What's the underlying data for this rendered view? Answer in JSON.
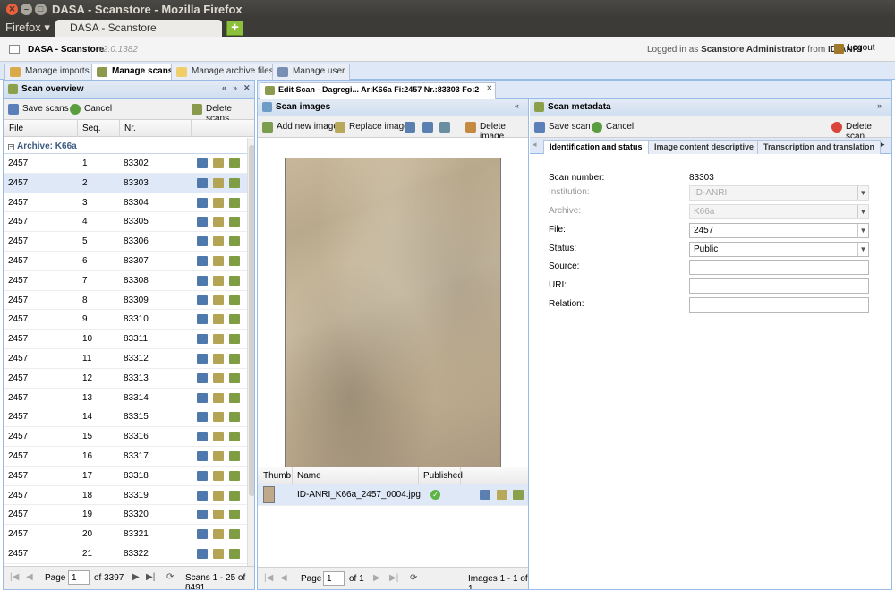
{
  "window": {
    "title": "DASA - Scanstore - Mozilla Firefox",
    "menu": "Firefox ▾",
    "tab": "DASA - Scanstore",
    "new_tab": "+"
  },
  "app": {
    "name": "DASA - Scanstore",
    "version": "v2.0.1382",
    "login_prefix": "Logged in as",
    "user": "Scanstore Administrator",
    "from": "from",
    "institution": "ID-ANRI",
    "logout": "Logout"
  },
  "main_tabs": [
    "Manage imports",
    "Manage scans",
    "Manage archive files",
    "Manage user"
  ],
  "overview": {
    "title": "Scan overview",
    "save": "Save scans",
    "cancel": "Cancel",
    "delete": "Delete scans",
    "columns": [
      "File",
      "Seq.",
      "Nr."
    ],
    "group": "Archive: K66a",
    "rows": [
      [
        "2457",
        "1",
        "83302"
      ],
      [
        "2457",
        "2",
        "83303"
      ],
      [
        "2457",
        "3",
        "83304"
      ],
      [
        "2457",
        "4",
        "83305"
      ],
      [
        "2457",
        "5",
        "83306"
      ],
      [
        "2457",
        "6",
        "83307"
      ],
      [
        "2457",
        "7",
        "83308"
      ],
      [
        "2457",
        "8",
        "83309"
      ],
      [
        "2457",
        "9",
        "83310"
      ],
      [
        "2457",
        "10",
        "83311"
      ],
      [
        "2457",
        "11",
        "83312"
      ],
      [
        "2457",
        "12",
        "83313"
      ],
      [
        "2457",
        "13",
        "83314"
      ],
      [
        "2457",
        "14",
        "83315"
      ],
      [
        "2457",
        "15",
        "83316"
      ],
      [
        "2457",
        "16",
        "83317"
      ],
      [
        "2457",
        "17",
        "83318"
      ],
      [
        "2457",
        "18",
        "83319"
      ],
      [
        "2457",
        "19",
        "83320"
      ],
      [
        "2457",
        "20",
        "83321"
      ],
      [
        "2457",
        "21",
        "83322"
      ]
    ],
    "pager": {
      "page_label": "Page",
      "page": "1",
      "of": "of 3397",
      "summary": "Scans 1 - 25 of 8491"
    }
  },
  "edit_tab": "Edit Scan - Dagregi... Ar:K66a Fi:2457 Nr.:83303 Fo:2",
  "images": {
    "title": "Scan images",
    "add": "Add new image",
    "replace": "Replace image",
    "delete": "Delete image",
    "columns": [
      "Thumb",
      "Name",
      "Published"
    ],
    "file": "ID-ANRI_K66a_2457_0004.jpg",
    "pager": {
      "page_label": "Page",
      "page": "1",
      "of": "of 1",
      "summary": "Images 1 - 1 of 1"
    }
  },
  "metadata": {
    "title": "Scan metadata",
    "save": "Save scan",
    "cancel": "Cancel",
    "delete": "Delete scan",
    "tabs": [
      "Identification and status",
      "Image content descriptive",
      "Transcription and translation"
    ],
    "fields": {
      "scan_number_label": "Scan number:",
      "scan_number": "83303",
      "institution_label": "Institution:",
      "institution": "ID-ANRI",
      "archive_label": "Archive:",
      "archive": "K66a",
      "file_label": "File:",
      "file": "2457",
      "status_label": "Status:",
      "status": "Public",
      "source_label": "Source:",
      "uri_label": "URI:",
      "relation_label": "Relation:"
    }
  },
  "colors": {
    "accent": "#99bbe8",
    "selected_row": "#dfe8f6",
    "header": "#3c3b37"
  }
}
